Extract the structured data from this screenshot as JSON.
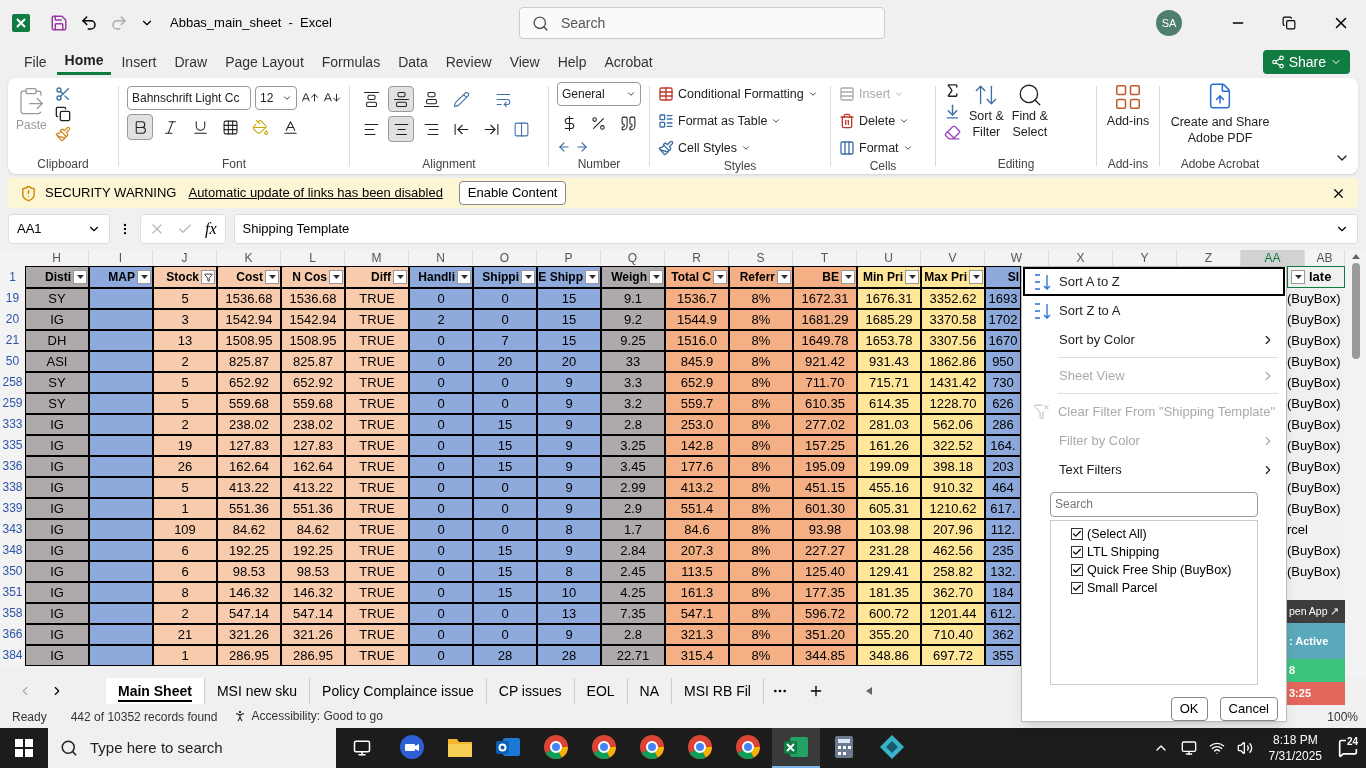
{
  "title_bar": {
    "title": "Abbas_main_sheet  -  Excel",
    "search": {
      "placeholder": "Search"
    },
    "avatar": "SA"
  },
  "menu": {
    "tabs": [
      {
        "label": "File",
        "selected": false
      },
      {
        "label": "Home",
        "selected": true
      },
      {
        "label": "Insert",
        "selected": false
      },
      {
        "label": "Draw",
        "selected": false
      },
      {
        "label": "Page Layout",
        "selected": false
      },
      {
        "label": "Formulas",
        "selected": false
      },
      {
        "label": "Data",
        "selected": false
      },
      {
        "label": "Review",
        "selected": false
      },
      {
        "label": "View",
        "selected": false
      },
      {
        "label": "Help",
        "selected": false
      },
      {
        "label": "Acrobat",
        "selected": false
      }
    ],
    "share": "Share"
  },
  "ribbon": {
    "clipboard": {
      "label": "Clipboard",
      "paste": "Paste"
    },
    "font": {
      "label": "Font",
      "family": "Bahnschrift Light Cc",
      "size": "12",
      "bold": true
    },
    "alignment": {
      "label": "Alignment",
      "vertical": [
        {
          "selected": false
        },
        {
          "selected": true
        },
        {
          "selected": false
        }
      ],
      "horizontal": [
        {
          "selected": false
        },
        {
          "selected": true
        },
        {
          "selected": false
        }
      ]
    },
    "number": {
      "label": "Number",
      "format": "General"
    },
    "styles": {
      "label": "Styles",
      "items": [
        "Conditional Formatting",
        "Format as Table",
        "Cell Styles"
      ]
    },
    "cells": {
      "label": "Cells",
      "items": [
        {
          "label": "Insert",
          "disabled": true
        },
        {
          "label": "Delete",
          "disabled": false
        },
        {
          "label": "Format",
          "disabled": false
        }
      ]
    },
    "editing": {
      "label": "Editing",
      "sort_filter": [
        "Sort &",
        "Filter"
      ],
      "find_select": [
        "Find &",
        "Select"
      ]
    },
    "addins": {
      "label": "Add-ins",
      "button": "Add-ins"
    },
    "acrobat": {
      "label": "Adobe Acrobat",
      "button": [
        "Create and Share",
        "Adobe PDF"
      ]
    }
  },
  "security_bar": {
    "title": "SECURITY WARNING",
    "message": "Automatic update of links has been disabled",
    "button": "Enable Content"
  },
  "formula_bar": {
    "name_box": "AA1",
    "fx": "fx",
    "formula": "Shipping Template"
  },
  "sheet": {
    "column_letters": [
      {
        "letter": "H",
        "selected": false
      },
      {
        "letter": "I",
        "selected": false
      },
      {
        "letter": "J",
        "selected": false
      },
      {
        "letter": "K",
        "selected": false
      },
      {
        "letter": "L",
        "selected": false
      },
      {
        "letter": "M",
        "selected": false
      },
      {
        "letter": "N",
        "selected": false
      },
      {
        "letter": "O",
        "selected": false
      },
      {
        "letter": "P",
        "selected": false
      },
      {
        "letter": "Q",
        "selected": false
      },
      {
        "letter": "R",
        "selected": false
      },
      {
        "letter": "S",
        "selected": false
      },
      {
        "letter": "T",
        "selected": false
      },
      {
        "letter": "U",
        "selected": false
      },
      {
        "letter": "V",
        "selected": false
      },
      {
        "letter": "W",
        "selected": false
      },
      {
        "letter": "X",
        "selected": false
      },
      {
        "letter": "Y",
        "selected": false
      },
      {
        "letter": "Z",
        "selected": false
      },
      {
        "letter": "AA",
        "selected": true
      },
      {
        "letter": "AB",
        "selected": false
      }
    ],
    "header_row": {
      "number": "1",
      "tail": "late"
    },
    "columns": [
      {
        "header": "Disti",
        "color": "#aeaaaa",
        "kind": "text",
        "filtered": false
      },
      {
        "header": "MAP",
        "color": "#8ea9db",
        "kind": "text",
        "filtered": false
      },
      {
        "header": "Stock",
        "color": "#f8cbad",
        "kind": "text",
        "filtered": true
      },
      {
        "header": "Cost",
        "color": "#f8cbad",
        "kind": "text",
        "filtered": false
      },
      {
        "header": "N Cos",
        "color": "#f8cbad",
        "kind": "text",
        "filtered": false
      },
      {
        "header": "Diff",
        "color": "#f8cbad",
        "kind": "text",
        "filtered": false
      },
      {
        "header": "Handli",
        "color": "#8ea9db",
        "kind": "text",
        "filtered": false
      },
      {
        "header": "Shippi",
        "color": "#8ea9db",
        "kind": "text",
        "filtered": false
      },
      {
        "header": "E Shipp",
        "color": "#8ea9db",
        "kind": "text",
        "filtered": false
      },
      {
        "header": "Weigh",
        "color": "#aeaaaa",
        "kind": "text",
        "filtered": false
      },
      {
        "header": "Total C",
        "color": "#f4b084",
        "kind": "text",
        "filtered": false
      },
      {
        "header": "Referr",
        "color": "#f4b084",
        "kind": "text",
        "filtered": false
      },
      {
        "header": "BE",
        "color": "#f4b084",
        "kind": "text",
        "filtered": false
      },
      {
        "header": "Min Pri",
        "color": "#ffe699",
        "kind": "text",
        "filtered": false
      },
      {
        "header": "Max Pri",
        "color": "#ffe699",
        "kind": "text",
        "filtered": false
      },
      {
        "header": "Sl",
        "color": "#8ea9db",
        "kind": "cut"
      }
    ],
    "rows": [
      {
        "number": "19",
        "cells": [
          "SY",
          "",
          "5",
          "1536.68",
          "1536.68",
          "TRUE",
          "0",
          "0",
          "15",
          "9.1",
          "1536.7",
          "8%",
          "1672.31",
          "1676.31",
          "3352.62",
          "1693"
        ],
        "tail": "(BuyBox)"
      },
      {
        "number": "20",
        "cells": [
          "IG",
          "",
          "3",
          "1542.94",
          "1542.94",
          "TRUE",
          "2",
          "0",
          "15",
          "9.2",
          "1544.9",
          "8%",
          "1681.29",
          "1685.29",
          "3370.58",
          "1702"
        ],
        "tail": "(BuyBox)"
      },
      {
        "number": "21",
        "cells": [
          "DH",
          "",
          "13",
          "1508.95",
          "1508.95",
          "TRUE",
          "0",
          "7",
          "15",
          "9.25",
          "1516.0",
          "8%",
          "1649.78",
          "1653.78",
          "3307.56",
          "1670"
        ],
        "tail": "(BuyBox)"
      },
      {
        "number": "50",
        "cells": [
          "ASI",
          "",
          "2",
          "825.87",
          "825.87",
          "TRUE",
          "0",
          "20",
          "20",
          "33",
          "845.9",
          "8%",
          "921.42",
          "931.43",
          "1862.86",
          "950"
        ],
        "tail": "(BuyBox)"
      },
      {
        "number": "258",
        "cells": [
          "SY",
          "",
          "5",
          "652.92",
          "652.92",
          "TRUE",
          "0",
          "0",
          "9",
          "3.3",
          "652.9",
          "8%",
          "711.70",
          "715.71",
          "1431.42",
          "730"
        ],
        "tail": "(BuyBox)"
      },
      {
        "number": "259",
        "cells": [
          "SY",
          "",
          "5",
          "559.68",
          "559.68",
          "TRUE",
          "0",
          "0",
          "9",
          "3.2",
          "559.7",
          "8%",
          "610.35",
          "614.35",
          "1228.70",
          "626"
        ],
        "tail": "(BuyBox)"
      },
      {
        "number": "333",
        "cells": [
          "IG",
          "",
          "2",
          "238.02",
          "238.02",
          "TRUE",
          "0",
          "15",
          "9",
          "2.8",
          "253.0",
          "8%",
          "277.02",
          "281.03",
          "562.06",
          "286"
        ],
        "tail": "(BuyBox)"
      },
      {
        "number": "335",
        "cells": [
          "IG",
          "",
          "19",
          "127.83",
          "127.83",
          "TRUE",
          "0",
          "15",
          "9",
          "3.25",
          "142.8",
          "8%",
          "157.25",
          "161.26",
          "322.52",
          "164."
        ],
        "tail": "(BuyBox)"
      },
      {
        "number": "336",
        "cells": [
          "IG",
          "",
          "26",
          "162.64",
          "162.64",
          "TRUE",
          "0",
          "15",
          "9",
          "3.45",
          "177.6",
          "8%",
          "195.09",
          "199.09",
          "398.18",
          "203"
        ],
        "tail": "(BuyBox)"
      },
      {
        "number": "338",
        "cells": [
          "IG",
          "",
          "5",
          "413.22",
          "413.22",
          "TRUE",
          "0",
          "0",
          "9",
          "2.99",
          "413.2",
          "8%",
          "451.15",
          "455.16",
          "910.32",
          "464"
        ],
        "tail": "(BuyBox)"
      },
      {
        "number": "339",
        "cells": [
          "IG",
          "",
          "1",
          "551.36",
          "551.36",
          "TRUE",
          "0",
          "0",
          "9",
          "2.9",
          "551.4",
          "8%",
          "601.30",
          "605.31",
          "1210.62",
          "617."
        ],
        "tail": "(BuyBox)"
      },
      {
        "number": "343",
        "cells": [
          "IG",
          "",
          "109",
          "84.62",
          "84.62",
          "TRUE",
          "0",
          "0",
          "8",
          "1.7",
          "84.6",
          "8%",
          "93.98",
          "103.98",
          "207.96",
          "112."
        ],
        "tail": "rcel"
      },
      {
        "number": "348",
        "cells": [
          "IG",
          "",
          "6",
          "192.25",
          "192.25",
          "TRUE",
          "0",
          "15",
          "9",
          "2.84",
          "207.3",
          "8%",
          "227.27",
          "231.28",
          "462.56",
          "235"
        ],
        "tail": "(BuyBox)"
      },
      {
        "number": "350",
        "cells": [
          "IG",
          "",
          "6",
          "98.53",
          "98.53",
          "TRUE",
          "0",
          "15",
          "8",
          "2.45",
          "113.5",
          "8%",
          "125.40",
          "129.41",
          "258.82",
          "132."
        ],
        "tail": "(BuyBox)"
      },
      {
        "number": "351",
        "cells": [
          "IG",
          "",
          "8",
          "146.32",
          "146.32",
          "TRUE",
          "0",
          "15",
          "10",
          "4.25",
          "161.3",
          "8%",
          "177.35",
          "181.35",
          "362.70",
          "184"
        ]
      },
      {
        "number": "358",
        "cells": [
          "IG",
          "",
          "2",
          "547.14",
          "547.14",
          "TRUE",
          "0",
          "0",
          "13",
          "7.35",
          "547.1",
          "8%",
          "596.72",
          "600.72",
          "1201.44",
          "612."
        ]
      },
      {
        "number": "366",
        "cells": [
          "IG",
          "",
          "21",
          "321.26",
          "321.26",
          "TRUE",
          "0",
          "0",
          "9",
          "2.8",
          "321.3",
          "8%",
          "351.20",
          "355.20",
          "710.40",
          "362"
        ]
      },
      {
        "number": "384",
        "cells": [
          "IG",
          "",
          "1",
          "286.95",
          "286.95",
          "TRUE",
          "0",
          "28",
          "28",
          "22.71",
          "315.4",
          "8%",
          "344.85",
          "348.86",
          "697.72",
          "355"
        ]
      }
    ]
  },
  "filter_menu": {
    "items": [
      {
        "kind": "sort-asc",
        "label": "Sort A to Z",
        "disabled": false,
        "selected": true
      },
      {
        "kind": "sort-desc",
        "label": "Sort Z to A",
        "disabled": false,
        "selected": false
      },
      {
        "kind": "submenu",
        "label": "Sort by Color",
        "disabled": false,
        "selected": false
      },
      {
        "kind": "divider"
      },
      {
        "kind": "submenu",
        "label": "Sheet View",
        "disabled": true,
        "selected": false
      },
      {
        "kind": "divider"
      },
      {
        "kind": "clear",
        "label": "Clear Filter From \"Shipping Template\"",
        "disabled": true,
        "selected": false
      },
      {
        "kind": "submenu",
        "label": "Filter by Color",
        "disabled": true,
        "selected": false
      },
      {
        "kind": "submenu",
        "label": "Text Filters",
        "disabled": false,
        "selected": false
      }
    ],
    "search": {
      "placeholder": "Search"
    },
    "values": [
      {
        "label": "(Select All)",
        "checked": true
      },
      {
        "label": "LTL Shipping",
        "checked": true
      },
      {
        "label": "Quick Free Ship (BuyBox)",
        "checked": true
      },
      {
        "label": "Small Parcel",
        "checked": true
      }
    ],
    "buttons": [
      "OK",
      "Cancel"
    ]
  },
  "side_widget": [
    {
      "text": "pen App ↗",
      "color": "#3d3d3d"
    },
    {
      "text": ": Active",
      "color": "#5aa9bb"
    },
    {
      "text": "8",
      "color": "#3cc47c"
    },
    {
      "text": "3:25",
      "color": "#e2665c"
    }
  ],
  "sheet_tabs": [
    {
      "label": "Main Sheet",
      "selected": true
    },
    {
      "label": "MSI new sku",
      "selected": false
    },
    {
      "label": "Policy Complaince issue",
      "selected": false
    },
    {
      "label": "CP issues",
      "selected": false
    },
    {
      "label": "EOL",
      "selected": false
    },
    {
      "label": "NA",
      "selected": false
    },
    {
      "label": "MSI RB Fil",
      "selected": false
    }
  ],
  "status_bar": {
    "mode": "Ready",
    "records": "442 of 10352 records found",
    "accessibility": "Accessibility: Good to go",
    "zoom": "100%"
  },
  "taskbar": {
    "search": {
      "placeholder": "Type here to search"
    },
    "time": "8:18 PM",
    "date": "7/31/2025",
    "badge": "24",
    "apps": [
      {
        "kind": "zoom",
        "selected": false
      },
      {
        "kind": "folder",
        "selected": false
      },
      {
        "kind": "outlook",
        "selected": false
      },
      {
        "kind": "browser",
        "selected": false
      },
      {
        "kind": "browser",
        "selected": false
      },
      {
        "kind": "browser",
        "selected": false
      },
      {
        "kind": "browser",
        "selected": false
      },
      {
        "kind": "browser",
        "selected": false
      },
      {
        "kind": "excel",
        "selected": true
      },
      {
        "kind": "calculator",
        "selected": false
      },
      {
        "kind": "diamond",
        "selected": false
      }
    ]
  }
}
